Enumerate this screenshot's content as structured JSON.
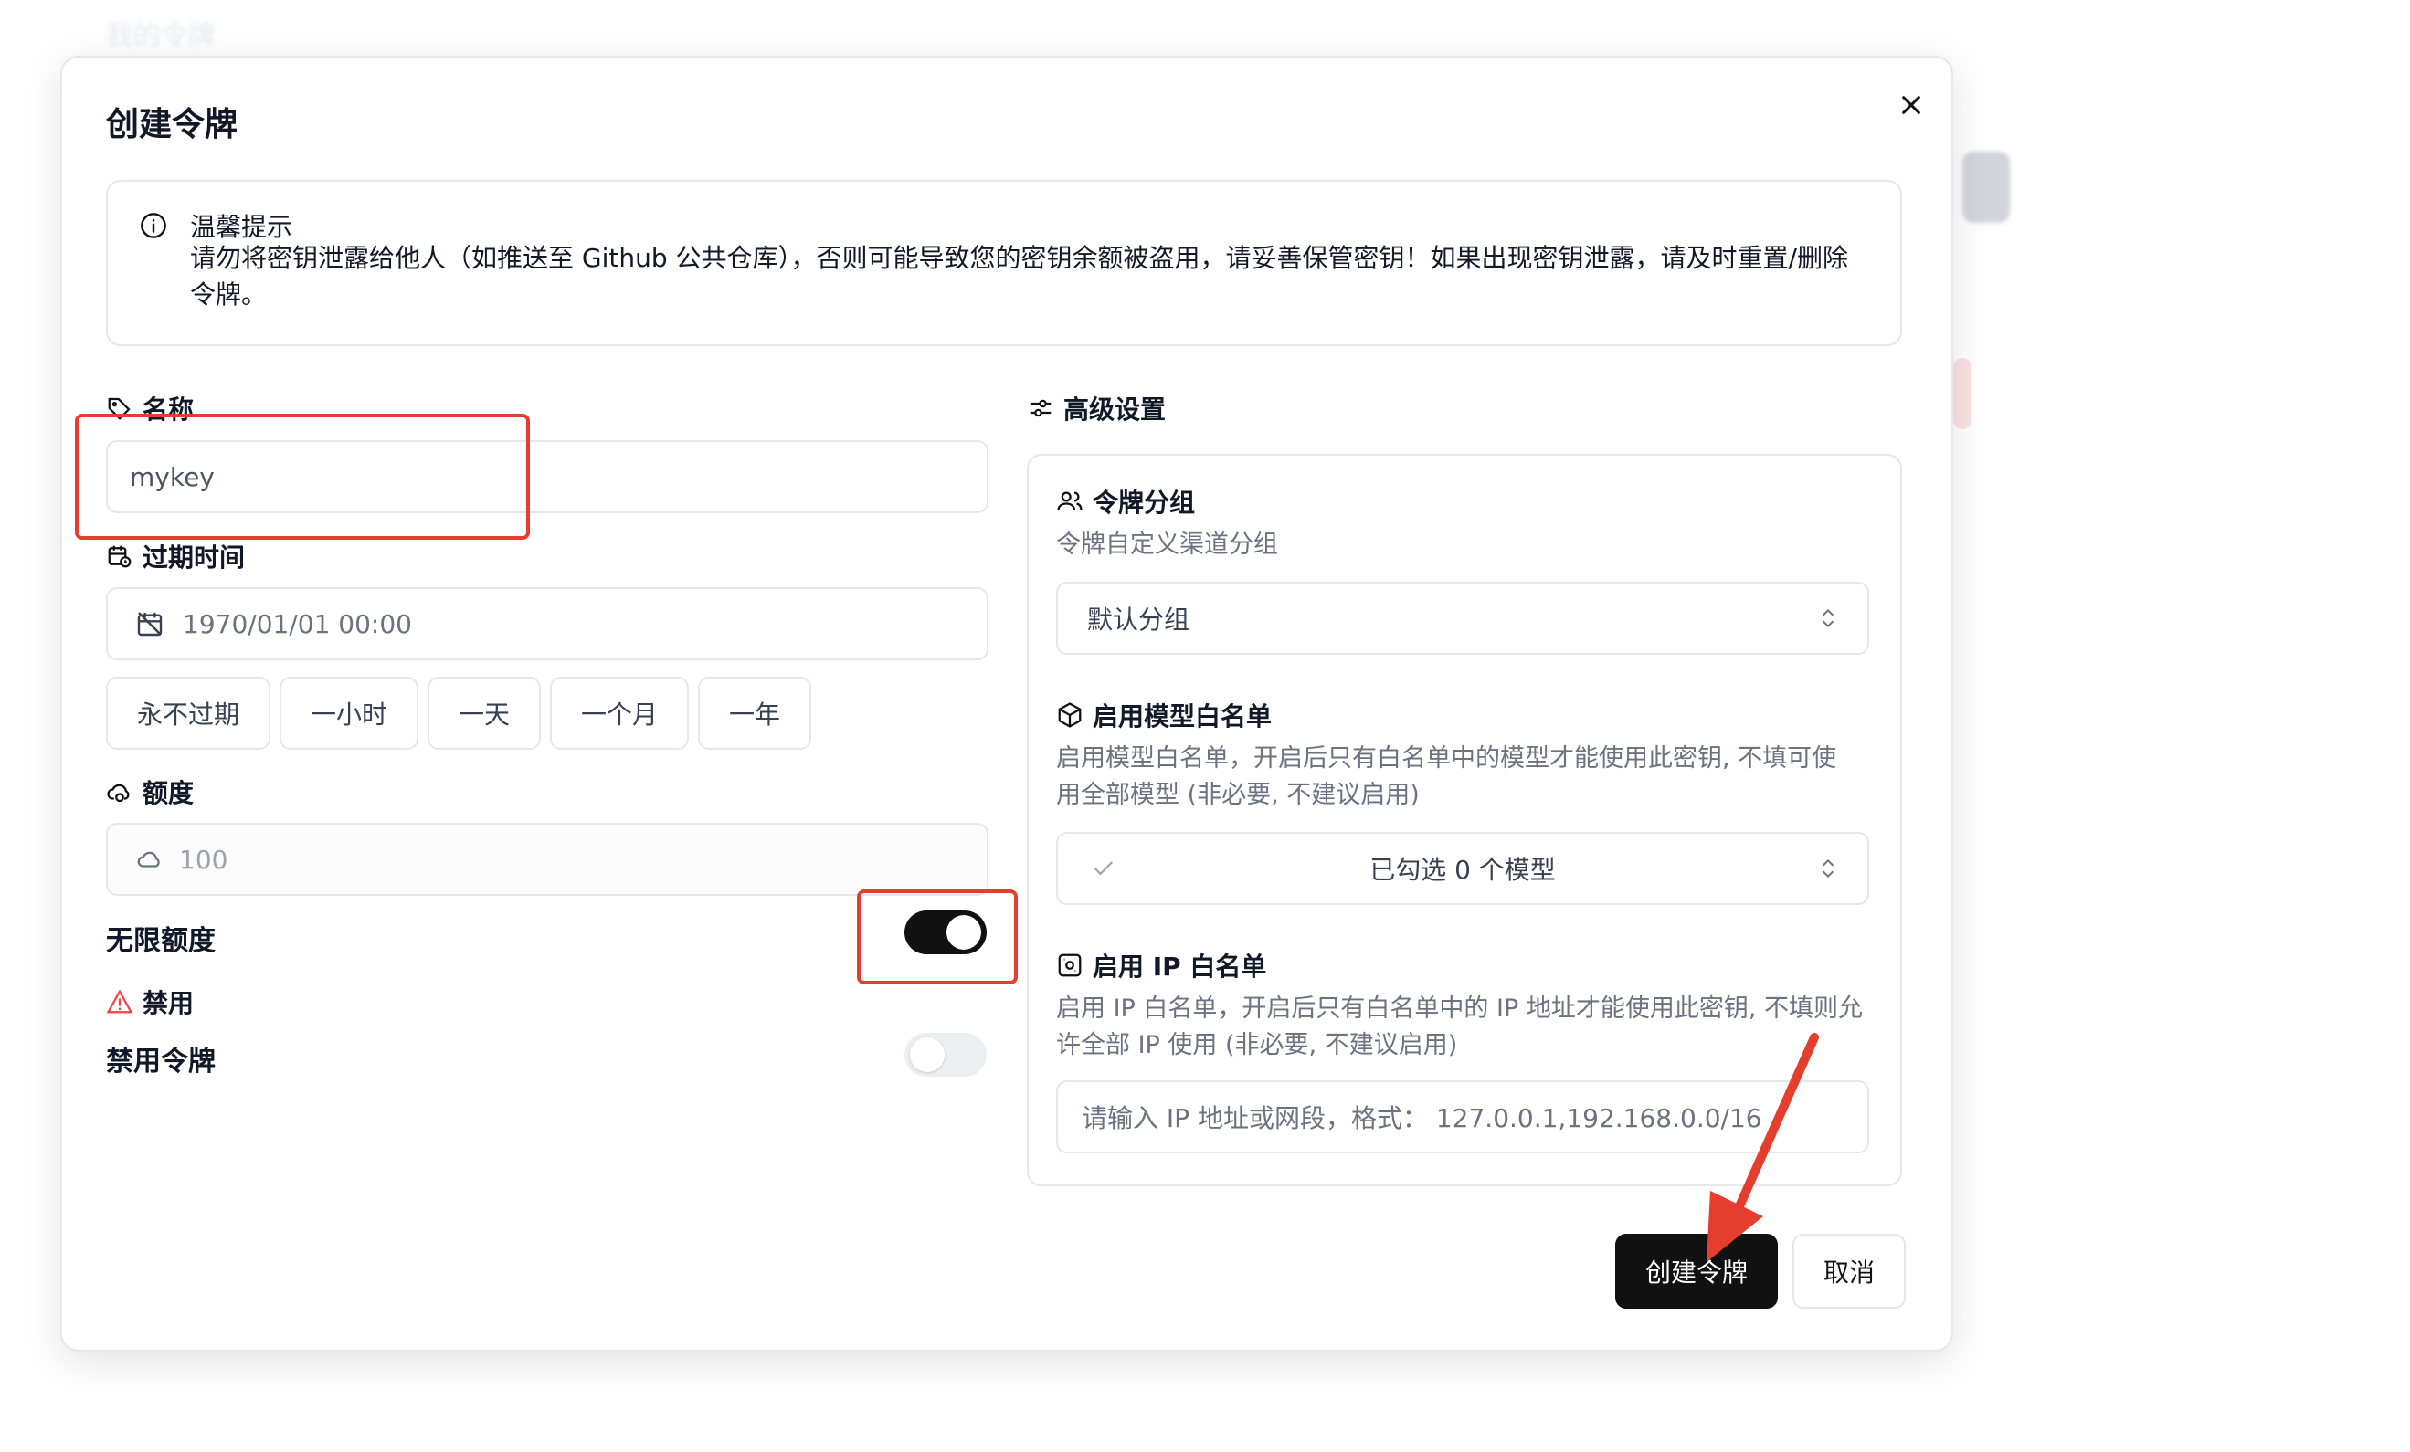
{
  "background": {
    "header_text": "我的令牌"
  },
  "dialog": {
    "title": "创建令牌",
    "alert": {
      "title": "温馨提示",
      "body": "请勿将密钥泄露给他人（如推送至 Github 公共仓库），否则可能导致您的密钥余额被盗用，请妥善保管密钥！如果出现密钥泄露，请及时重置/删除令牌。"
    },
    "name": {
      "label": "名称",
      "value": "mykey"
    },
    "expire": {
      "label": "过期时间",
      "value": "1970/01/01 00:00",
      "presets": [
        "永不过期",
        "一小时",
        "一天",
        "一个月",
        "一年"
      ]
    },
    "quota": {
      "label": "额度",
      "placeholder": "100"
    },
    "unlimited": {
      "label": "无限额度",
      "enabled": true
    },
    "disable": {
      "section_label": "禁用",
      "label": "禁用令牌",
      "enabled": false
    },
    "advanced": {
      "label": "高级设置",
      "group": {
        "label": "令牌分组",
        "desc": "令牌自定义渠道分组",
        "value": "默认分组"
      },
      "model_whitelist": {
        "label": "启用模型白名单",
        "desc": "启用模型白名单，开启后只有白名单中的模型才能使用此密钥, 不填可使用全部模型 (非必要, 不建议启用)",
        "value": "已勾选 0 个模型"
      },
      "ip_whitelist": {
        "label": "启用 IP 白名单",
        "desc": "启用 IP 白名单，开启后只有白名单中的 IP 地址才能使用此密钥, 不填则允许全部 IP 使用 (非必要, 不建议启用)",
        "placeholder": "请输入 IP 地址或网段，格式： 127.0.0.1,192.168.0.0/16"
      }
    },
    "buttons": {
      "create": "创建令牌",
      "cancel": "取消"
    }
  },
  "colors": {
    "primary": "#111111",
    "annotation": "#e53e2f",
    "border": "#e5e7eb",
    "warning": "#ef4444"
  }
}
